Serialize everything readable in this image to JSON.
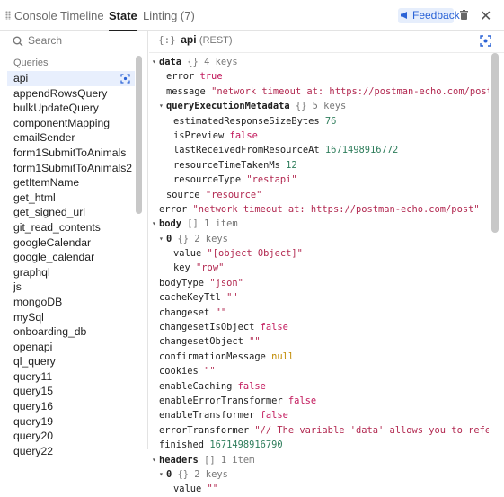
{
  "tabs": {
    "console": "Console",
    "timeline": "Timeline",
    "state": "State",
    "linting": "Linting (7)"
  },
  "feedback": {
    "label": "Feedback"
  },
  "search": {
    "placeholder": "Search"
  },
  "queries": {
    "section_label": "Queries",
    "items": [
      "api",
      "appendRowsQuery",
      "bulkUpdateQuery",
      "componentMapping",
      "emailSender",
      "form1SubmitToAnimals",
      "form1SubmitToAnimals2",
      "getItemName",
      "get_html",
      "get_signed_url",
      "git_read_contents",
      "googleCalendar",
      "google_calendar",
      "graphql",
      "js",
      "mongoDB",
      "mySql",
      "onboarding_db",
      "openapi",
      "ql_query",
      "query11",
      "query15",
      "query16",
      "query19",
      "query20",
      "query22"
    ]
  },
  "detail": {
    "brace": "{:}",
    "name": "api",
    "type": "(REST)"
  },
  "colors": {
    "accent": "#2b63d6",
    "selected_bg": "#e8effd",
    "string": "#b22850",
    "number": "#2e7d5b",
    "boolean": "#c2185b",
    "null": "#c08a00"
  },
  "tree": [
    {
      "indent": 0,
      "toggle": "▾",
      "key": "data",
      "bold": true,
      "meta": "{} 4 keys"
    },
    {
      "indent": 1,
      "key": "error",
      "value": "true",
      "vtype": "bool"
    },
    {
      "indent": 1,
      "key": "message",
      "value": "\"network timeout at: https://postman-echo.com/post\"",
      "vtype": "str"
    },
    {
      "indent": 1,
      "toggle": "▾",
      "key": "queryExecutionMetadata",
      "bold": true,
      "meta": "{} 5 keys"
    },
    {
      "indent": 2,
      "key": "estimatedResponseSizeBytes",
      "value": "76",
      "vtype": "num"
    },
    {
      "indent": 2,
      "key": "isPreview",
      "value": "false",
      "vtype": "bool"
    },
    {
      "indent": 2,
      "key": "lastReceivedFromResourceAt",
      "value": "1671498916772",
      "vtype": "num"
    },
    {
      "indent": 2,
      "key": "resourceTimeTakenMs",
      "value": "12",
      "vtype": "num"
    },
    {
      "indent": 2,
      "key": "resourceType",
      "value": "\"restapi\"",
      "vtype": "str"
    },
    {
      "indent": 1,
      "key": "source",
      "value": "\"resource\"",
      "vtype": "str"
    },
    {
      "indent": 0,
      "key": "error",
      "value": "\"network timeout at: https://postman-echo.com/post\"",
      "vtype": "str"
    },
    {
      "indent": 0,
      "toggle": "▾",
      "key": "body",
      "bold": true,
      "meta": "[] 1 item"
    },
    {
      "indent": 1,
      "toggle": "▾",
      "key": "0",
      "bold": true,
      "meta": "{} 2 keys"
    },
    {
      "indent": 2,
      "key": "value",
      "value": "\"[object Object]\"",
      "vtype": "str"
    },
    {
      "indent": 2,
      "key": "key",
      "value": "\"row\"",
      "vtype": "str"
    },
    {
      "indent": 0,
      "key": "bodyType",
      "value": "\"json\"",
      "vtype": "str"
    },
    {
      "indent": 0,
      "key": "cacheKeyTtl",
      "value": "\"\"",
      "vtype": "str"
    },
    {
      "indent": 0,
      "key": "changeset",
      "value": "\"\"",
      "vtype": "str"
    },
    {
      "indent": 0,
      "key": "changesetIsObject",
      "value": "false",
      "vtype": "bool"
    },
    {
      "indent": 0,
      "key": "changesetObject",
      "value": "\"\"",
      "vtype": "str"
    },
    {
      "indent": 0,
      "key": "confirmationMessage",
      "value": "null",
      "vtype": "null"
    },
    {
      "indent": 0,
      "key": "cookies",
      "value": "\"\"",
      "vtype": "str"
    },
    {
      "indent": 0,
      "key": "enableCaching",
      "value": "false",
      "vtype": "bool"
    },
    {
      "indent": 0,
      "key": "enableErrorTransformer",
      "value": "false",
      "vtype": "bool"
    },
    {
      "indent": 0,
      "key": "enableTransformer",
      "value": "false",
      "vtype": "bool"
    },
    {
      "indent": 0,
      "key": "errorTransformer",
      "value": "\"// The variable 'data' allows you to reference …",
      "vtype": "str"
    },
    {
      "indent": 0,
      "key": "finished",
      "value": "1671498916790",
      "vtype": "num"
    },
    {
      "indent": 0,
      "toggle": "▾",
      "key": "headers",
      "bold": true,
      "meta": "[] 1 item"
    },
    {
      "indent": 1,
      "toggle": "▾",
      "key": "0",
      "bold": true,
      "meta": "{} 2 keys"
    },
    {
      "indent": 2,
      "key": "value",
      "value": "\"\"",
      "vtype": "str"
    }
  ]
}
